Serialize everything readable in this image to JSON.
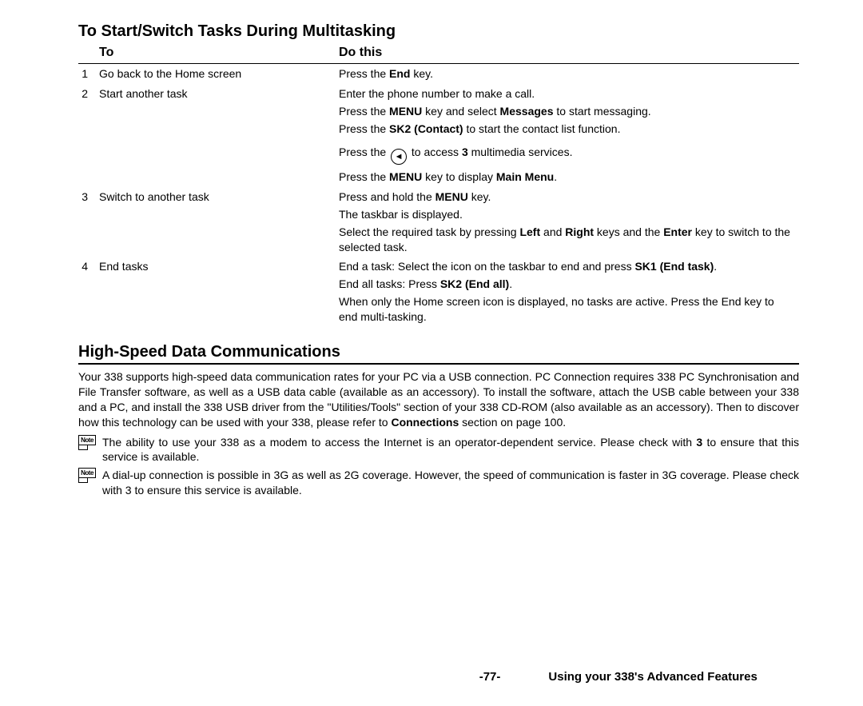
{
  "heading1": "To Start/Switch Tasks During Multitasking",
  "table": {
    "header_to": "To",
    "header_do": "Do this",
    "rows": [
      {
        "n": "1",
        "to": "Go back to the Home screen",
        "do_pre": "Press the ",
        "do_b1": "End",
        "do_post": " key."
      },
      {
        "n": "2",
        "to": "Start another task",
        "l1": "Enter the phone number to make a call.",
        "l2a": "Press the ",
        "l2b": "MENU",
        "l2c": " key and select ",
        "l2d": "Messages",
        "l2e": " to start messaging.",
        "l3a": "Press the ",
        "l3b": "SK2 (Contact)",
        "l3c": " to start the contact list function.",
        "l4a": "Press the ",
        "l4b": " to access ",
        "l4c": "3",
        "l4d": " multimedia services.",
        "l5a": "Press the ",
        "l5b": "MENU",
        "l5c": " key to display ",
        "l5d": "Main Menu",
        "l5e": "."
      },
      {
        "n": "3",
        "to": "Switch to another task",
        "l1a": "Press and hold the ",
        "l1b": "MENU",
        "l1c": " key.",
        "l2": "The taskbar is displayed.",
        "l3a": "Select the required task by pressing ",
        "l3b": "Left",
        "l3c": " and ",
        "l3d": "Right",
        "l3e": " keys and the ",
        "l3f": "Enter",
        "l3g": " key to switch to the selected task."
      },
      {
        "n": "4",
        "to": "End tasks",
        "l1a": "End a task: Select the icon on the taskbar to end and press ",
        "l1b": "SK1 (End task)",
        "l1c": ".",
        "l2a": "End all tasks: Press ",
        "l2b": "SK2 (End all)",
        "l2c": ".",
        "l3": "When only the Home screen icon is displayed, no tasks are active. Press the End key to end multi-tasking."
      }
    ]
  },
  "heading2": "High-Speed Data Communications",
  "para1a": "Your 338 supports high-speed data communication rates for your PC via a USB connection. PC Connection requires 338 PC Synchronisation and File Transfer software, as well as a USB data cable (available as an accessory). To install the software, attach the USB cable between your 338 and a PC, and install the 338 USB driver from the \"Utilities/Tools\" section of your 338 CD-ROM (also available as an accessory). Then to discover how this technology can be used with your 338, please refer to ",
  "para1b": "Connections",
  "para1c": " section on page 100.",
  "noteLabel": "Note",
  "note1a": "The ability to use your 338 as a modem to access the Internet is an operator-dependent service. Please check with ",
  "note1b": "3",
  "note1c": " to ensure that this service is available.",
  "note2": "A dial-up connection is possible in 3G as well as 2G coverage. However, the speed of communication is faster in 3G coverage. Please check with 3 to ensure this service is available.",
  "pageNum": "-77-",
  "chapter": "Using your 338's Advanced Features"
}
